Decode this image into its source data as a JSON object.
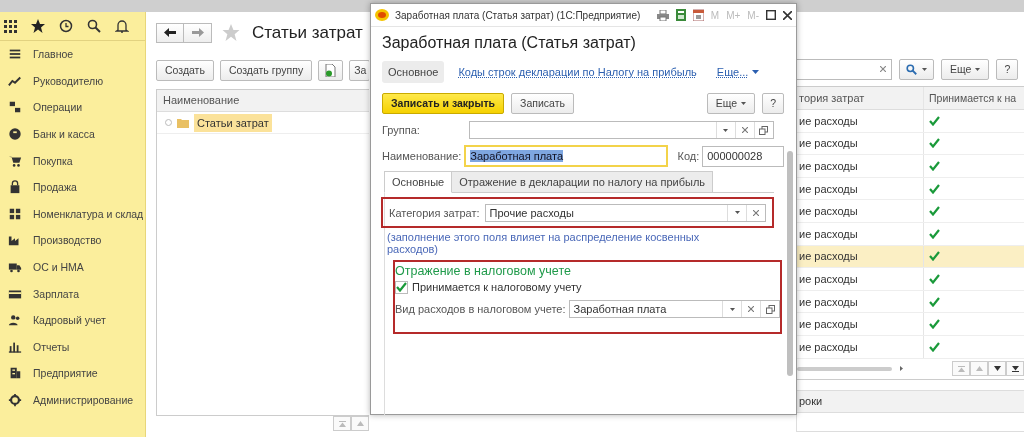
{
  "sidebar": {
    "items": [
      "Главное",
      "Руководителю",
      "Операции",
      "Банк и касса",
      "Покупка",
      "Продажа",
      "Номенклатура и склад",
      "Производство",
      "ОС и НМА",
      "Зарплата",
      "Кадровый учет",
      "Отчеты",
      "Предприятие",
      "Администрирование"
    ]
  },
  "list_page": {
    "title": "Статьи затрат",
    "toolbar": [
      "Создать",
      "Создать группу",
      "За"
    ],
    "tree": {
      "column": "Наименование",
      "rows": [
        {
          "label": "Статьи затрат",
          "selected": true
        }
      ]
    }
  },
  "right_table": {
    "more_button": "Еще",
    "help_button": "?",
    "columns": [
      "тория затрат",
      "Принимается к на"
    ],
    "rows": [
      {
        "column_1": "ие расходы",
        "checked": true,
        "selected": false
      },
      {
        "column_1": "ие расходы",
        "checked": true,
        "selected": false
      },
      {
        "column_1": "ие расходы",
        "checked": true,
        "selected": false
      },
      {
        "column_1": "ие расходы",
        "checked": true,
        "selected": false
      },
      {
        "column_1": "ие расходы",
        "checked": true,
        "selected": false
      },
      {
        "column_1": "ие расходы",
        "checked": true,
        "selected": false
      },
      {
        "column_1": "ие расходы",
        "checked": true,
        "selected": true
      },
      {
        "column_1": "ие расходы",
        "checked": true,
        "selected": false
      },
      {
        "column_1": "ие расходы",
        "checked": true,
        "selected": false
      },
      {
        "column_1": "ие расходы",
        "checked": true,
        "selected": false
      },
      {
        "column_1": "ие расходы",
        "checked": true,
        "selected": false
      }
    ],
    "lower_panel": {
      "column": "роки"
    }
  },
  "dialog": {
    "window_title": "Заработная плата (Статья затрат) (1С:Предприятие)",
    "memory_buttons": [
      "M",
      "M+",
      "M-"
    ],
    "heading": "Заработная плата (Статья затрат)",
    "nav": [
      {
        "label": "Основное",
        "selected": true
      },
      {
        "label": "Коды строк декларации по Налогу на прибыль",
        "selected": false
      }
    ],
    "nav_more": "Еще...",
    "buttons": {
      "primary": "Записать и закрыть",
      "secondary": "Записать",
      "more": "Еще",
      "help": "?"
    },
    "group": {
      "label": "Группа:"
    },
    "name": {
      "label": "Наименование:",
      "value": "Заработная плата"
    },
    "code": {
      "label": "Код:",
      "value": "000000028"
    },
    "tabs": [
      {
        "label": "Основные",
        "selected": true
      },
      {
        "label": "Отражение в декларации по налогу на прибыль",
        "selected": false
      }
    ],
    "category": {
      "label": "Категория затрат:",
      "value": "Прочие расходы"
    },
    "note": "(заполнение этого поля влияет на распределение косвенных расходов)",
    "tax": {
      "heading": "Отражение в налоговом учете",
      "accepted": {
        "label": "Принимается к налоговому учету",
        "checked": true
      },
      "expense_type": {
        "label": "Вид расходов в налоговом учете:",
        "value": "Заработная плата"
      }
    }
  }
}
